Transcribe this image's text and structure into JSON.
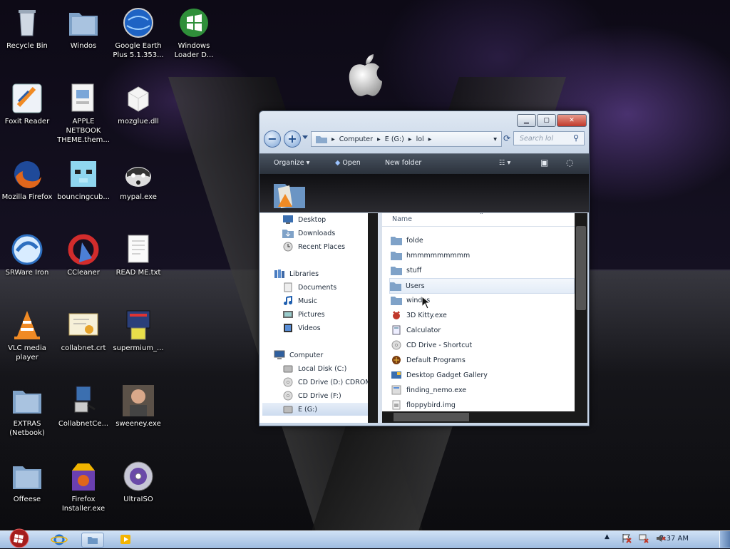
{
  "desktop": {
    "icons": [
      {
        "label": "Recycle Bin",
        "icon": "recycle-bin-icon"
      },
      {
        "label": "Windos",
        "icon": "folder-icon"
      },
      {
        "label": "Google Earth Plus 5.1.353...",
        "icon": "google-earth-icon"
      },
      {
        "label": "Windows Loader D...",
        "icon": "windows-orb-icon"
      },
      {
        "label": "Foxit Reader",
        "icon": "foxit-reader-icon"
      },
      {
        "label": "APPLE NETBOOK THEME.them...",
        "icon": "theme-file-icon"
      },
      {
        "label": "mozglue.dll",
        "icon": "dll-file-icon"
      },
      {
        "label": "Mozilla Firefox",
        "icon": "firefox-icon"
      },
      {
        "label": "bouncingcub...",
        "icon": "minecraft-cube-icon"
      },
      {
        "label": "mypal.exe",
        "icon": "raccoon-icon"
      },
      {
        "label": "SRWare Iron",
        "icon": "srware-iron-icon"
      },
      {
        "label": "CCleaner",
        "icon": "ccleaner-icon"
      },
      {
        "label": "READ ME.txt",
        "icon": "text-file-icon"
      },
      {
        "label": "VLC media player",
        "icon": "vlc-cone-icon"
      },
      {
        "label": "collabnet.crt",
        "icon": "certificate-icon"
      },
      {
        "label": "supermium_...",
        "icon": "installer-icon"
      },
      {
        "label": "EXTRAS (Netbook)",
        "icon": "folder-icon"
      },
      {
        "label": "CollabnetCe...",
        "icon": "setup-computer-icon"
      },
      {
        "label": "sweeney.exe",
        "icon": "person-photo-icon"
      },
      {
        "label": "Offeese",
        "icon": "folder-icon"
      },
      {
        "label": "Firefox Installer.exe",
        "icon": "firefox-installer-icon"
      },
      {
        "label": "UltraISO",
        "icon": "disc-icon"
      }
    ]
  },
  "explorer": {
    "breadcrumb": [
      "Computer",
      "E (G:)",
      "lol"
    ],
    "search_placeholder": "Search lol",
    "toolbar": {
      "organize": "Organize",
      "open": "Open",
      "new_folder": "New folder"
    },
    "nav_pane": {
      "favorites": [
        "Desktop",
        "Downloads",
        "Recent Places"
      ],
      "libraries_label": "Libraries",
      "libraries": [
        "Documents",
        "Music",
        "Pictures",
        "Videos"
      ],
      "computer_label": "Computer",
      "drives": [
        "Local Disk (C:)",
        "CD Drive (D:) CDROM",
        "CD Drive (F:)",
        "E (G:)"
      ],
      "selected": "E (G:)"
    },
    "file_list": {
      "column_name": "Name",
      "items": [
        {
          "name": "folde",
          "icon": "folder-icon"
        },
        {
          "name": "hmmmmmmmmm",
          "icon": "folder-icon"
        },
        {
          "name": "stuff",
          "icon": "folder-icon"
        },
        {
          "name": "Users",
          "icon": "folder-icon"
        },
        {
          "name": "windos",
          "icon": "folder-icon"
        },
        {
          "name": "3D Kitty.exe",
          "icon": "kitty-exe-icon"
        },
        {
          "name": "Calculator",
          "icon": "calculator-icon"
        },
        {
          "name": "CD Drive - Shortcut",
          "icon": "cd-shortcut-icon"
        },
        {
          "name": "Default Programs",
          "icon": "default-programs-icon"
        },
        {
          "name": "Desktop Gadget Gallery",
          "icon": "gadget-gallery-icon"
        },
        {
          "name": "finding_nemo.exe",
          "icon": "exe-icon"
        },
        {
          "name": "floppybird.img",
          "icon": "img-file-icon"
        }
      ],
      "highlighted": "Users"
    }
  },
  "taskbar": {
    "clock": "7:37 AM"
  },
  "colors": {
    "window_chrome": "#c8d6e7",
    "command_bar": "#2b323c",
    "taskbar": "#9ebbe0",
    "folder": "#7fa2c8"
  }
}
